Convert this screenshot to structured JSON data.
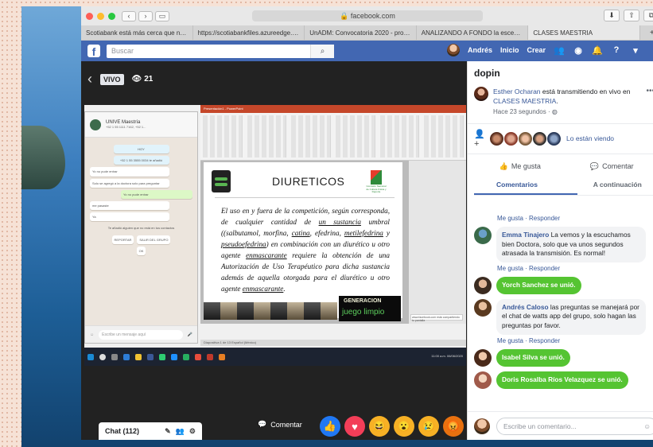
{
  "browser": {
    "url": "facebook.com",
    "tabs": [
      "Scotiabank está más cerca que nunca |...",
      "https://scotiabankfiles.azureedge.net/s...",
      "UnADM: Convocatoria 2020 - promod...",
      "ANALIZANDO A FONDO la escena d...",
      "CLASES MAESTRIA"
    ],
    "new_tab": "+"
  },
  "fb": {
    "logo": "f",
    "search_placeholder": "Buscar",
    "user": "Andrés",
    "nav": [
      "Inicio",
      "Crear"
    ]
  },
  "video": {
    "live_label": "VIVO",
    "viewers": "21",
    "whatsapp": {
      "group": "UNIVE Maestría",
      "members": "+52 1 55 1111 7162, +52 1...",
      "day_label": "HOY",
      "system_msg": "+52 1 55 3555 0034 te añadió",
      "msgs": [
        "Yo no pude entrar",
        "Solo se agregó a la doctora solo para preguntar",
        "Yo no pude entrar",
        "me pasaste",
        "Ya"
      ],
      "notice": "Te añadió alguien que no está en tus contactos",
      "buttons": [
        "REPORTAR",
        "SALIR DEL GRUPO",
        "OK"
      ],
      "input_placeholder": "Escribe un mensaje aquí"
    },
    "ppt_title": "Presentación1 - PowerPoint",
    "slide": {
      "title": "DIURETICOS",
      "logo_text": "Comisión Nacional de Cultura Física y Deporte",
      "generacion": "GENERACION",
      "juego": "juego limpio"
    },
    "notification": "www.facebook.com está compartiendo tu pantalla",
    "statusbar": "Diapositiva 1 de 13   Español (México)",
    "clock": "11:00 a.m. 06/06/2020",
    "chat_label": "Chat (112)",
    "comment_label": "Comentar"
  },
  "sidebar": {
    "page_title": "dopin",
    "post_author": "Esther Ocharan",
    "post_mid": " está transmitiendo en vivo en ",
    "post_group": "CLASES MAESTRIA",
    "post_end": ".",
    "post_time": "Hace 23 segundos · ",
    "watching_label": "Lo están viendo",
    "actions": [
      "Me gusta",
      "Comentar"
    ],
    "subtabs": [
      "Comentarios",
      "A continuación"
    ],
    "comment_actions": "Me gusta · Responder",
    "comments": [
      {
        "name": "Emma Tinajero",
        "text": " La vemos y la escuchamos bien Doctora, solo que va unos segundos atrasada la transmisión. Es normal!",
        "type": "comment"
      },
      {
        "name": "Yorch Sanchez",
        "text": " se unió.",
        "type": "join"
      },
      {
        "name": "Andrés Caloso",
        "text": " las preguntas se manejará por el chat de watts app del grupo, solo hagan las preguntas por favor.",
        "type": "comment"
      },
      {
        "name": "Isabel Silva",
        "text": " se unió.",
        "type": "join"
      },
      {
        "name": "Doris Rosalba Ríos Velazquez",
        "text": " se unió.",
        "type": "join"
      }
    ],
    "write_placeholder": "Escribe un comentario..."
  },
  "colors": {
    "fb_blue": "#4267b2",
    "link": "#385898",
    "join_green": "#55c432",
    "slide_green": "#5ed05e"
  }
}
